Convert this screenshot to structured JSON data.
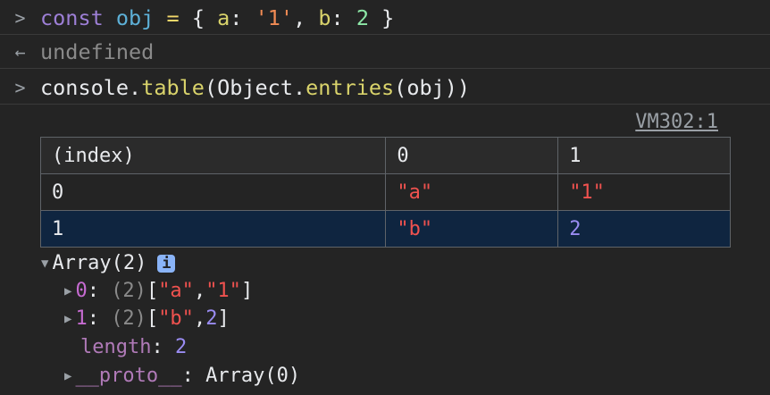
{
  "lines": [
    {
      "prompt": ">",
      "tokens": {
        "kw": "const",
        "var": "obj",
        "eq": "=",
        "open": "{",
        "a": "a",
        "c1": ":",
        "s1": "'1'",
        "comma": ",",
        "b": "b",
        "c2": ":",
        "n": "2",
        "close": "}"
      }
    },
    {
      "prompt": "←",
      "text": "undefined"
    },
    {
      "prompt": ">",
      "tokens": {
        "t1": "console.",
        "t2": "table",
        "t3": "(Object.",
        "t4": "entries",
        "t5": "(obj))"
      }
    }
  ],
  "source_link": "VM302:1",
  "table": {
    "headers": [
      "(index)",
      "0",
      "1"
    ],
    "rows": [
      [
        "0",
        "\"a\"",
        "\"1\""
      ],
      [
        "1",
        "\"b\"",
        "2"
      ]
    ]
  },
  "tree": {
    "root": "Array(2)",
    "info": "i",
    "items": [
      {
        "key": "0",
        "count": "(2)",
        "open": "[",
        "v1": "\"a\"",
        "sep": ",",
        "v2": "\"1\"",
        "close": "]"
      },
      {
        "key": "1",
        "count": "(2)",
        "open": "[",
        "v1": "\"b\"",
        "sep": ",",
        "v2": "2",
        "close": "]"
      }
    ],
    "length_key": "length",
    "length_val": "2",
    "proto_key": "__proto__",
    "proto_val": "Array(0)"
  }
}
